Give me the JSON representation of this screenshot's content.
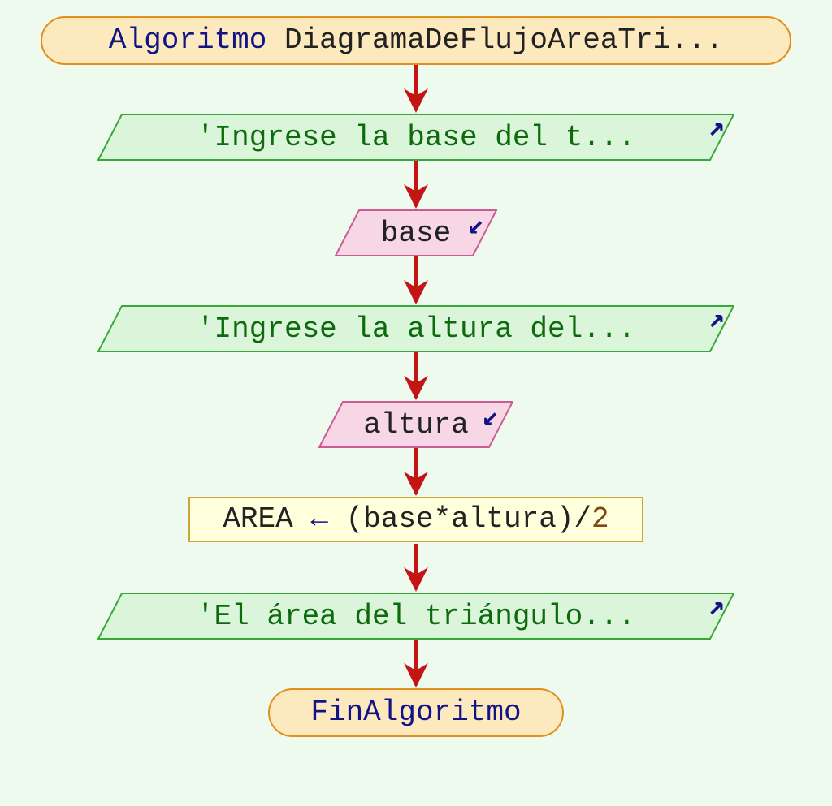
{
  "colors": {
    "background": "#edfaed",
    "terminal_fill": "#fce9bd",
    "terminal_stroke": "#e28f1c",
    "output_fill": "#dbf5db",
    "output_stroke": "#38a838",
    "input_fill": "#f7d7e5",
    "input_stroke": "#cc5b94",
    "process_fill": "#feffdb",
    "process_stroke": "#cfa43a",
    "arrow": "#c41515",
    "keyword": "#131388",
    "string": "#0d6a0d",
    "number": "#7a4a10"
  },
  "nodes": {
    "n1": {
      "kind": "terminal",
      "keyword": "Algoritmo",
      "rest": " DiagramaDeFlujoAreaTri..."
    },
    "n2": {
      "kind": "output",
      "text": "'Ingrese la base del t..."
    },
    "n3": {
      "kind": "input",
      "text": "base"
    },
    "n4": {
      "kind": "output",
      "text": "'Ingrese la altura del..."
    },
    "n5": {
      "kind": "input",
      "text": "altura"
    },
    "n6": {
      "kind": "process",
      "lhs": "AREA",
      "assign": " ← ",
      "expr_open": "(",
      "expr_a": "base",
      "expr_op": "*",
      "expr_b": "altura",
      "expr_close": ")",
      "div": "/",
      "divnum": "2"
    },
    "n7": {
      "kind": "output",
      "text": "'El área del triángulo..."
    },
    "n8": {
      "kind": "terminal",
      "keyword": "FinAlgoritmo",
      "rest": ""
    }
  },
  "io_arrows": {
    "out": "↗",
    "in": "↙"
  }
}
